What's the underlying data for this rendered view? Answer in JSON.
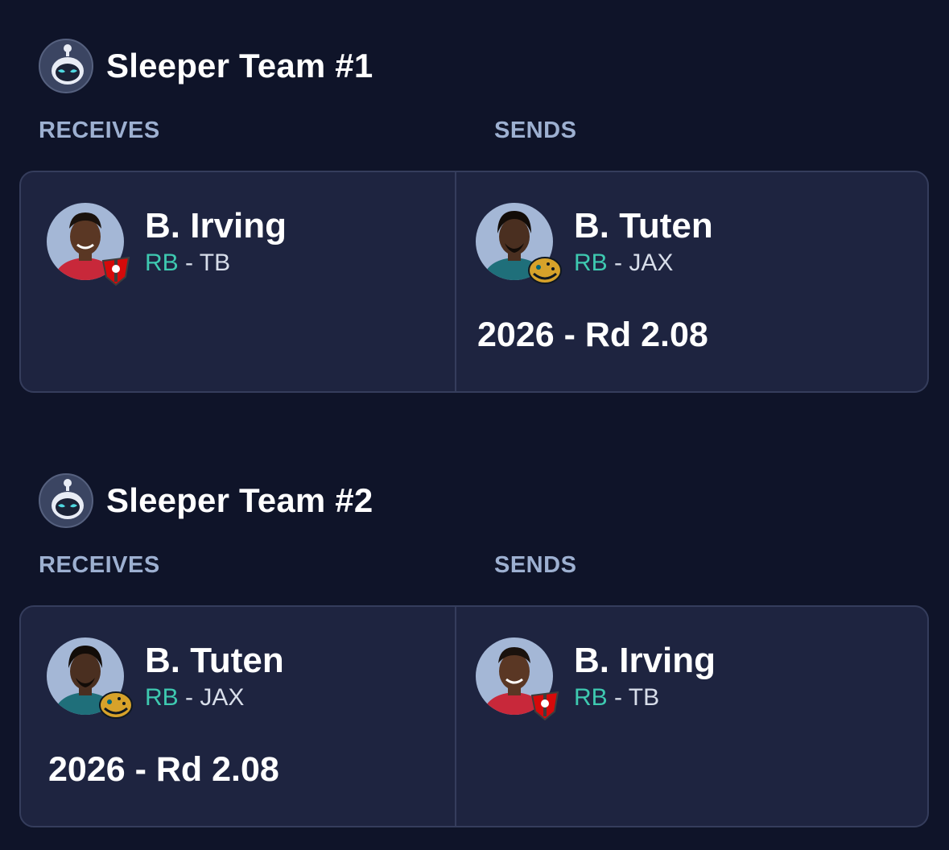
{
  "colors": {
    "background": "#0f1429",
    "card": "#1e2440",
    "card_border": "#353d5c",
    "label": "#9db0d1",
    "position": "#3ec9b0"
  },
  "teams": [
    {
      "name": "Sleeper Team #1",
      "logo_icon": "sleeper-robot-icon",
      "receives_label": "RECEIVES",
      "sends_label": "SENDS",
      "receives": {
        "player": {
          "name": "B. Irving",
          "position": "RB",
          "team_text": " - TB",
          "team_badge": "buccaneers-logo-icon"
        },
        "pick": ""
      },
      "sends": {
        "player": {
          "name": "B. Tuten",
          "position": "RB",
          "team_text": " - JAX",
          "team_badge": "jaguars-logo-icon"
        },
        "pick": "2026 - Rd 2.08"
      }
    },
    {
      "name": "Sleeper Team #2",
      "logo_icon": "sleeper-robot-icon",
      "receives_label": "RECEIVES",
      "sends_label": "SENDS",
      "receives": {
        "player": {
          "name": "B. Tuten",
          "position": "RB",
          "team_text": " - JAX",
          "team_badge": "jaguars-logo-icon"
        },
        "pick": "2026 - Rd 2.08"
      },
      "sends": {
        "player": {
          "name": "B. Irving",
          "position": "RB",
          "team_text": " - TB",
          "team_badge": "buccaneers-logo-icon"
        },
        "pick": ""
      }
    }
  ]
}
